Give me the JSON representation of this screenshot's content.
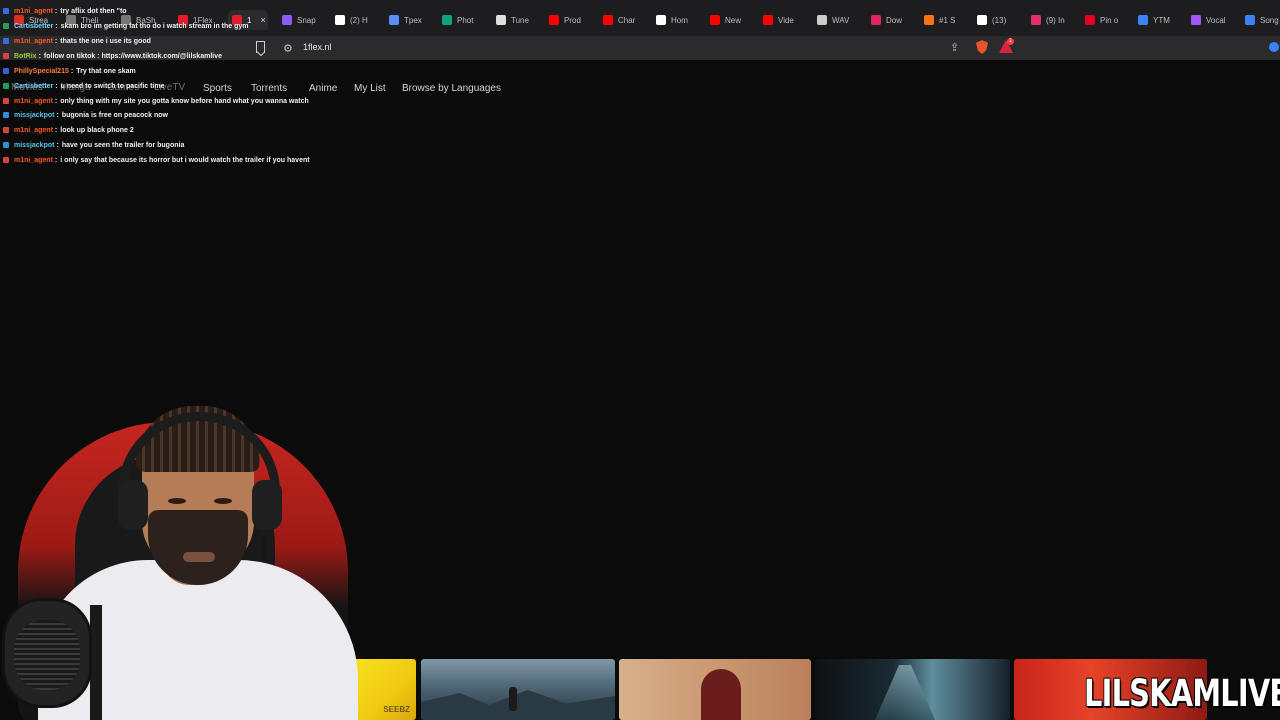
{
  "tabs": [
    {
      "label": "Strea",
      "icon": "stream-favicon",
      "color": "#d93025",
      "active": false
    },
    {
      "label": "Theli",
      "icon": "generic-favicon",
      "color": "#777777",
      "active": false
    },
    {
      "label": "BaSh",
      "icon": "generic-favicon",
      "color": "#777777",
      "active": false
    },
    {
      "label": "1Flex",
      "icon": "flix-favicon",
      "color": "#e21b2c",
      "active": false
    },
    {
      "label": "1",
      "icon": "flix-favicon",
      "color": "#e21b2c",
      "active": true
    },
    {
      "label": "Snap",
      "icon": "snap-favicon",
      "color": "#8b5cf6",
      "active": false
    },
    {
      "label": "(2) H",
      "icon": "x-favicon",
      "color": "#ffffff",
      "active": false
    },
    {
      "label": "Tpex",
      "icon": "tpex-favicon",
      "color": "#5b8cff",
      "active": false
    },
    {
      "label": "Phot",
      "icon": "chatgpt-favicon",
      "color": "#10a37f",
      "active": false
    },
    {
      "label": "Tune",
      "icon": "gear-favicon",
      "color": "#dddddd",
      "active": false
    },
    {
      "label": "Prod",
      "icon": "youtube-favicon",
      "color": "#ff0000",
      "active": false
    },
    {
      "label": "Char",
      "icon": "youtube-favicon",
      "color": "#ff0000",
      "active": false
    },
    {
      "label": "Hom",
      "icon": "x-favicon",
      "color": "#ffffff",
      "active": false
    },
    {
      "label": "New",
      "icon": "youtube-favicon",
      "color": "#ff0000",
      "active": false
    },
    {
      "label": "Vide",
      "icon": "youtube-favicon",
      "color": "#ff0000",
      "active": false
    },
    {
      "label": "WAV",
      "icon": "cloud-favicon",
      "color": "#cccccc",
      "active": false
    },
    {
      "label": "Dow",
      "icon": "download-favicon",
      "color": "#e0245e",
      "active": false
    },
    {
      "label": "#1 S",
      "icon": "store-favicon",
      "color": "#f97316",
      "active": false
    },
    {
      "label": "(13)",
      "icon": "tiktok-favicon",
      "color": "#ffffff",
      "active": false
    },
    {
      "label": "(9) In",
      "icon": "instagram-favicon",
      "color": "#e1306c",
      "active": false
    },
    {
      "label": "Pin o",
      "icon": "pinterest-favicon",
      "color": "#e60023",
      "active": false
    },
    {
      "label": "YTM",
      "icon": "ytm-favicon",
      "color": "#3b82f6",
      "active": false
    },
    {
      "label": "Vocal",
      "icon": "vocal-favicon",
      "color": "#a855f7",
      "active": false
    },
    {
      "label": "Song",
      "icon": "song-favicon",
      "color": "#3b82f6",
      "active": false
    }
  ],
  "address_bar": {
    "url": "1flex.nl",
    "rewards_badge": "1"
  },
  "site_nav": {
    "items": [
      "Movies",
      "Manga",
      "Games",
      "LiveTV",
      "Sports",
      "Torrents",
      "Anime",
      "My List",
      "Browse by Languages"
    ]
  },
  "chat": {
    "messages": [
      {
        "user": "m1ni_agent",
        "text": "try aflix dot then \"to",
        "color": "#ff5a1f"
      },
      {
        "user": "Cartisbetter",
        "text": "skam bro im getting fat tho do i watch stream in the gym",
        "color": "#6fd6ff"
      },
      {
        "user": "m1ni_agent",
        "text": "thats the one i use its good",
        "color": "#ff5a1f"
      },
      {
        "user": "BotRix",
        "text": "follow on tiktok : https://www.tiktok.com/@lilskamlive",
        "color": "#9acd32"
      },
      {
        "user": "PhillySpecial215",
        "text": "Try that one skam",
        "color": "#ff7b3a"
      },
      {
        "user": "Cartisbetter",
        "text": "u need to switch to pacific time",
        "color": "#6fd6ff"
      },
      {
        "user": "m1ni_agent",
        "text": "only thing with my site you gotta know before hand what you wanna watch",
        "color": "#ff5a1f"
      },
      {
        "user": "missjackpot",
        "text": "bugonia is free on peacock now",
        "color": "#58c4e6"
      },
      {
        "user": "m1ni_agent",
        "text": "look up black phone 2",
        "color": "#ff5a1f"
      },
      {
        "user": "missjackpot",
        "text": "have you seen the trailer for bugonia",
        "color": "#58c4e6"
      },
      {
        "user": "m1ni_agent",
        "text": "i only say that because its horror but i would watch the trailer if you havent",
        "color": "#ff5a1f"
      }
    ]
  },
  "thumbnails": [
    {
      "tag": "SEEBZ"
    },
    {
      "tag": ""
    },
    {
      "tag": ""
    },
    {
      "tag": ""
    },
    {
      "tag": ""
    }
  ],
  "overlay": {
    "watermark": "LILSKAMLIVE"
  },
  "colors": {
    "page_bg": "#0b0b0b",
    "tabstrip_bg": "#1d1d1f",
    "toolbar_bg": "#2b2b2e",
    "chat_separator": "#ffffff"
  }
}
